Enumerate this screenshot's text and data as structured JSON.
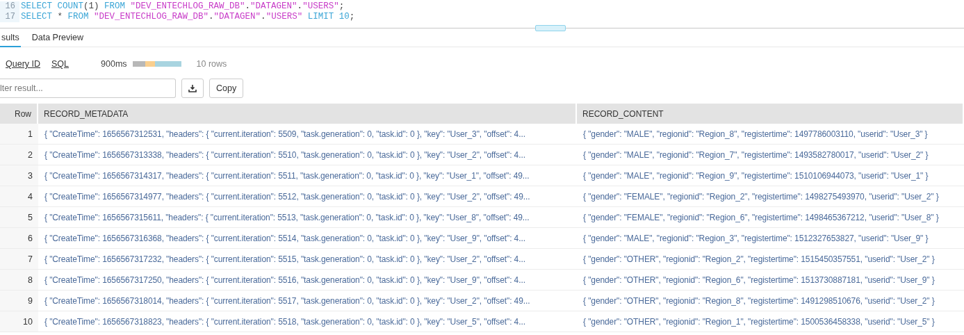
{
  "editor": {
    "lines": [
      {
        "number": "16",
        "tokens": [
          {
            "kind": "keyword",
            "text": "SELECT COUNT"
          },
          {
            "kind": "plain",
            "text": "(1) "
          },
          {
            "kind": "keyword",
            "text": "FROM "
          },
          {
            "kind": "string",
            "text": "\"DEV_ENTECHLOG_RAW_DB\""
          },
          {
            "kind": "plain",
            "text": "."
          },
          {
            "kind": "string",
            "text": "\"DATAGEN\""
          },
          {
            "kind": "plain",
            "text": "."
          },
          {
            "kind": "string",
            "text": "\"USERS\""
          },
          {
            "kind": "plain",
            "text": ";"
          }
        ]
      },
      {
        "number": "17",
        "tokens": [
          {
            "kind": "keyword",
            "text": "SELECT "
          },
          {
            "kind": "plain",
            "text": "* "
          },
          {
            "kind": "keyword",
            "text": "FROM "
          },
          {
            "kind": "string",
            "text": "\"DEV_ENTECHLOG_RAW_DB\""
          },
          {
            "kind": "plain",
            "text": "."
          },
          {
            "kind": "string",
            "text": "\"DATAGEN\""
          },
          {
            "kind": "plain",
            "text": "."
          },
          {
            "kind": "string",
            "text": "\"USERS\""
          },
          {
            "kind": "keyword",
            "text": " LIMIT 10"
          },
          {
            "kind": "plain",
            "text": ";"
          }
        ]
      }
    ]
  },
  "tabs": [
    {
      "label": "sults",
      "selected": true
    },
    {
      "label": "Data Preview",
      "selected": false
    }
  ],
  "query_info": {
    "links": [
      "Query ID",
      "SQL"
    ],
    "duration": "900ms",
    "timing_segments": [
      {
        "color": "#b8b8b8"
      },
      {
        "color": "#f9cf8f"
      },
      {
        "color": "#a8d4e0"
      }
    ],
    "row_count": "10 rows"
  },
  "filter": {
    "placeholder": "lter result...",
    "copy_button": "Copy"
  },
  "table": {
    "columns": [
      "Row",
      "RECORD_METADATA",
      "RECORD_CONTENT"
    ],
    "rows": [
      [
        "1",
        "{ \"CreateTime\": 1656567312531, \"headers\": { \"current.iteration\": 5509, \"task.generation\": 0, \"task.id\": 0 }, \"key\": \"User_3\", \"offset\": 4...",
        "{ \"gender\": \"MALE\", \"regionid\": \"Region_8\", \"registertime\": 1497786003110, \"userid\": \"User_3\" }"
      ],
      [
        "2",
        "{ \"CreateTime\": 1656567313338, \"headers\": { \"current.iteration\": 5510, \"task.generation\": 0, \"task.id\": 0 }, \"key\": \"User_2\", \"offset\": 4...",
        "{ \"gender\": \"MALE\", \"regionid\": \"Region_7\", \"registertime\": 1493582780017, \"userid\": \"User_2\" }"
      ],
      [
        "3",
        "{ \"CreateTime\": 1656567314317, \"headers\": { \"current.iteration\": 5511, \"task.generation\": 0, \"task.id\": 0 }, \"key\": \"User_1\", \"offset\": 49...",
        "{ \"gender\": \"MALE\", \"regionid\": \"Region_9\", \"registertime\": 1510106944073, \"userid\": \"User_1\" }"
      ],
      [
        "4",
        "{ \"CreateTime\": 1656567314977, \"headers\": { \"current.iteration\": 5512, \"task.generation\": 0, \"task.id\": 0 }, \"key\": \"User_2\", \"offset\": 49...",
        "{ \"gender\": \"FEMALE\", \"regionid\": \"Region_2\", \"registertime\": 1498275493970, \"userid\": \"User_2\" }"
      ],
      [
        "5",
        "{ \"CreateTime\": 1656567315611, \"headers\": { \"current.iteration\": 5513, \"task.generation\": 0, \"task.id\": 0 }, \"key\": \"User_8\", \"offset\": 49...",
        "{ \"gender\": \"FEMALE\", \"regionid\": \"Region_6\", \"registertime\": 1498465367212, \"userid\": \"User_8\" }"
      ],
      [
        "6",
        "{ \"CreateTime\": 1656567316368, \"headers\": { \"current.iteration\": 5514, \"task.generation\": 0, \"task.id\": 0 }, \"key\": \"User_9\", \"offset\": 4...",
        "{ \"gender\": \"MALE\", \"regionid\": \"Region_3\", \"registertime\": 1512327653827, \"userid\": \"User_9\" }"
      ],
      [
        "7",
        "{ \"CreateTime\": 1656567317232, \"headers\": { \"current.iteration\": 5515, \"task.generation\": 0, \"task.id\": 0 }, \"key\": \"User_2\", \"offset\": 4...",
        "{ \"gender\": \"OTHER\", \"regionid\": \"Region_2\", \"registertime\": 1515450357551, \"userid\": \"User_2\" }"
      ],
      [
        "8",
        "{ \"CreateTime\": 1656567317250, \"headers\": { \"current.iteration\": 5516, \"task.generation\": 0, \"task.id\": 0 }, \"key\": \"User_9\", \"offset\": 4...",
        "{ \"gender\": \"OTHER\", \"regionid\": \"Region_6\", \"registertime\": 1513730887181, \"userid\": \"User_9\" }"
      ],
      [
        "9",
        "{ \"CreateTime\": 1656567318014, \"headers\": { \"current.iteration\": 5517, \"task.generation\": 0, \"task.id\": 0 }, \"key\": \"User_2\", \"offset\": 49...",
        "{ \"gender\": \"OTHER\", \"regionid\": \"Region_8\", \"registertime\": 1491298510676, \"userid\": \"User_2\" }"
      ],
      [
        "10",
        "{ \"CreateTime\": 1656567318823, \"headers\": { \"current.iteration\": 5518, \"task.generation\": 0, \"task.id\": 0 }, \"key\": \"User_5\", \"offset\": 4...",
        "{ \"gender\": \"OTHER\", \"regionid\": \"Region_1\", \"registertime\": 1500536458338, \"userid\": \"User_5\" }"
      ]
    ]
  }
}
